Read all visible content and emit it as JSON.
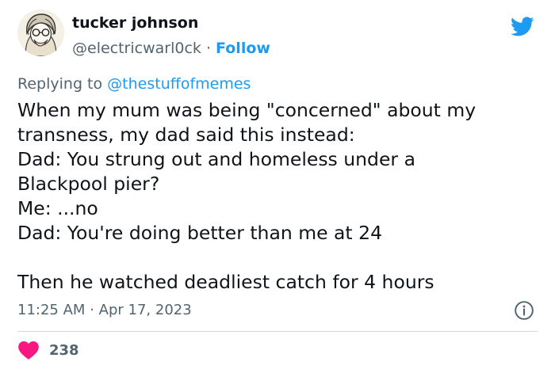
{
  "author": {
    "display_name": "tucker johnson",
    "handle": "@electricwarl0ck",
    "separator": "·",
    "follow_label": "Follow"
  },
  "reply": {
    "prefix": "Replying to",
    "handle": "@thestuffofmemes"
  },
  "tweet_lines": [
    "When my mum was being \"concerned\" about my",
    "transness, my dad said this instead:",
    "Dad: You strung out and homeless under a",
    "Blackpool pier?",
    "Me: ...no",
    "Dad: You're doing better than me at 24",
    "",
    "Then he watched deadliest catch for 4 hours"
  ],
  "meta": {
    "time": "11:25 AM",
    "separator": "·",
    "date": "Apr 17, 2023"
  },
  "engagement": {
    "likes": "238"
  },
  "icons": {
    "brand": "twitter-bird-icon",
    "info": "info-icon",
    "like": "heart-icon"
  },
  "colors": {
    "brand_blue": "#1d9bf0",
    "secondary_text": "#536471",
    "heart": "#f91880",
    "divider": "#cfd9de"
  }
}
